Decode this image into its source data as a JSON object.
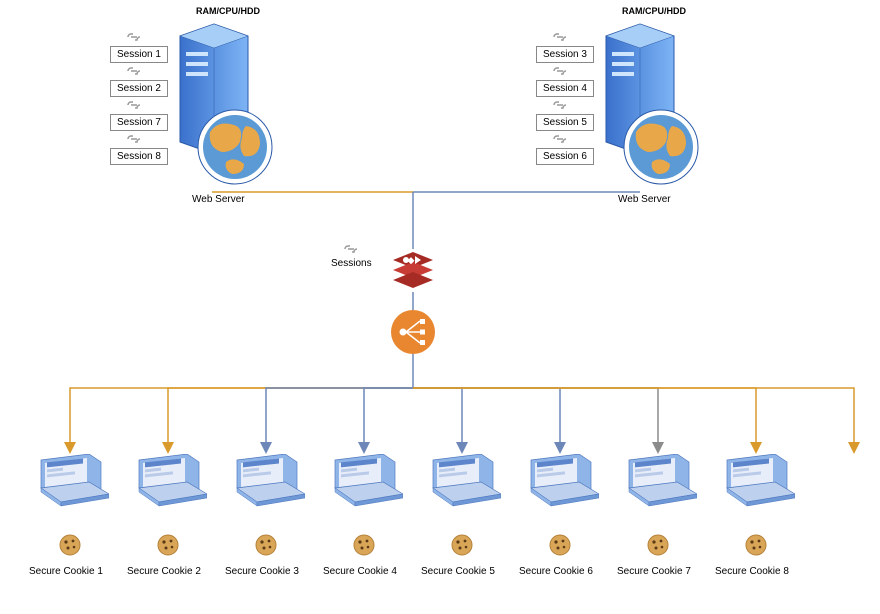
{
  "server1": {
    "title": "RAM/CPU/HDD",
    "caption": "Web Server",
    "sessions": [
      "Session 1",
      "Session 2",
      "Session 7",
      "Session 8"
    ]
  },
  "server2": {
    "title": "RAM/CPU/HDD",
    "caption": "Web Server",
    "sessions": [
      "Session 3",
      "Session 4",
      "Session 5",
      "Session 6"
    ]
  },
  "middle": {
    "sessions_label": "Sessions"
  },
  "clients": [
    {
      "cookie": "Secure Cookie 1"
    },
    {
      "cookie": "Secure Cookie 2"
    },
    {
      "cookie": "Secure Cookie 3"
    },
    {
      "cookie": "Secure Cookie 4"
    },
    {
      "cookie": "Secure Cookie 5"
    },
    {
      "cookie": "Secure Cookie 6"
    },
    {
      "cookie": "Secure Cookie 7"
    },
    {
      "cookie": "Secure Cookie 8"
    }
  ],
  "colors": {
    "blue": "#6d87b8",
    "orange": "#d99a2b",
    "gray": "#8b8b8b"
  }
}
